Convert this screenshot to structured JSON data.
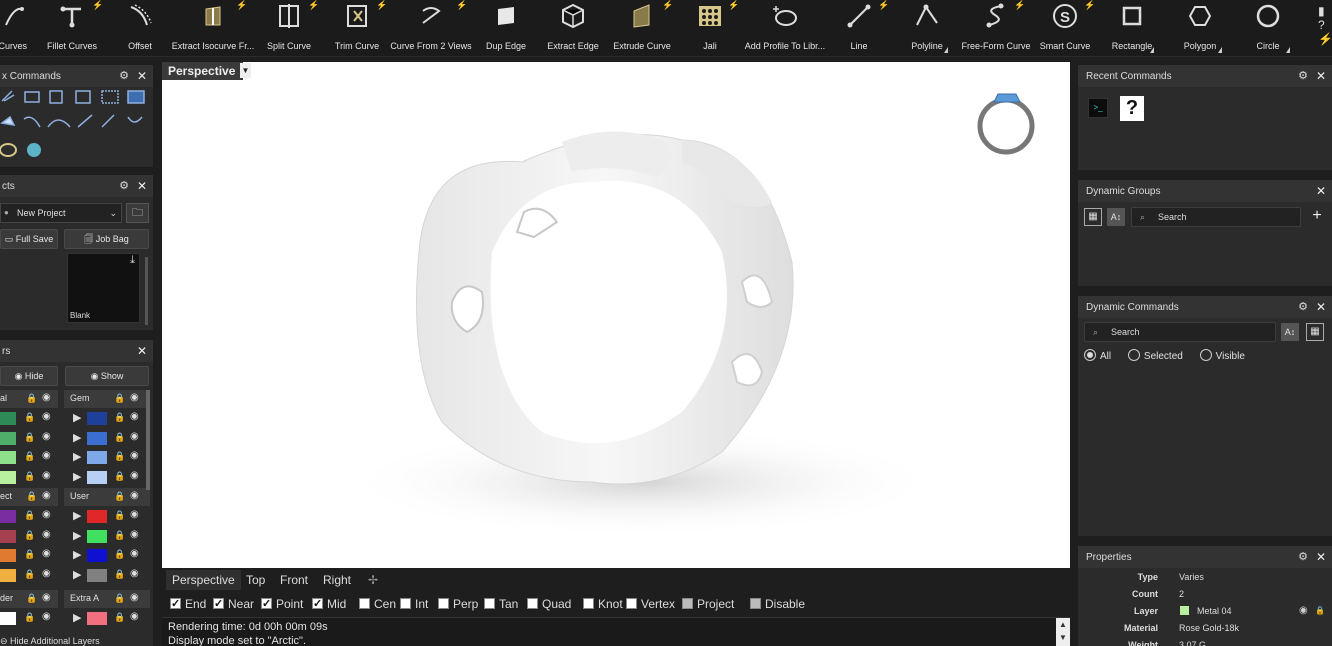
{
  "toolbar": {
    "tools": [
      {
        "label": "l Curves",
        "icon": "curves-icon"
      },
      {
        "label": "Fillet Curves",
        "icon": "fillet-curves-icon"
      },
      {
        "label": "Offset",
        "icon": "offset-icon"
      },
      {
        "label": "Extract Isocurve Fr...",
        "icon": "extract-isocurve-icon"
      },
      {
        "label": "Split Curve",
        "icon": "split-curve-icon"
      },
      {
        "label": "Trim Curve",
        "icon": "trim-curve-icon"
      },
      {
        "label": "Curve From 2 Views",
        "icon": "curve-from-2-views-icon"
      },
      {
        "label": "Dup Edge",
        "icon": "dup-edge-icon"
      },
      {
        "label": "Extract Edge",
        "icon": "extract-edge-icon"
      },
      {
        "label": "Extrude Curve",
        "icon": "extrude-curve-icon"
      },
      {
        "label": "Jali",
        "icon": "jali-icon"
      },
      {
        "label": "Add Profile To Libr...",
        "icon": "add-profile-icon"
      },
      {
        "label": "Line",
        "icon": "line-icon"
      },
      {
        "label": "Polyline",
        "icon": "polyline-icon"
      },
      {
        "label": "Free-Form Curve",
        "icon": "free-form-curve-icon"
      },
      {
        "label": "Smart Curve",
        "icon": "smart-curve-icon"
      },
      {
        "label": "Rectangle",
        "icon": "rectangle-icon"
      },
      {
        "label": "Polygon",
        "icon": "polygon-icon"
      },
      {
        "label": "Circle",
        "icon": "circle-icon"
      }
    ]
  },
  "left": {
    "commands_title": "x Commands",
    "projects_title": "cts",
    "project_select": "New Project",
    "full_save": "Full Save",
    "job_bag": "Job Bag",
    "thumb_label": "Blank",
    "layers_title": "rs",
    "hide": "Hide",
    "show": "Show",
    "group_left": [
      "al",
      "ect",
      "der"
    ],
    "group_right": [
      "Gem",
      "User",
      "Extra A"
    ],
    "hide_additional": "Hide Additional Layers"
  },
  "viewport": {
    "title": "Perspective",
    "tabs": [
      "Perspective",
      "Top",
      "Front",
      "Right"
    ]
  },
  "snaps": [
    {
      "label": "End",
      "on": true
    },
    {
      "label": "Near",
      "on": true
    },
    {
      "label": "Point",
      "on": true
    },
    {
      "label": "Mid",
      "on": true
    },
    {
      "label": "Cen",
      "on": false
    },
    {
      "label": "Int",
      "on": false
    },
    {
      "label": "Perp",
      "on": false
    },
    {
      "label": "Tan",
      "on": false
    },
    {
      "label": "Quad",
      "on": false
    },
    {
      "label": "Knot",
      "on": false
    },
    {
      "label": "Vertex",
      "on": false
    },
    {
      "label": "Project",
      "on": false
    },
    {
      "label": "Disable",
      "on": false
    }
  ],
  "cmdline": {
    "line1": "Rendering time: 0d 00h 00m 09s",
    "line2": "Display mode set to \"Arctic\"."
  },
  "right": {
    "recent_title": "Recent Commands",
    "groups_title": "Dynamic Groups",
    "groups_search": "Search",
    "commands_title": "Dynamic Commands",
    "commands_search": "Search",
    "radio_all": "All",
    "radio_selected": "Selected",
    "radio_visible": "Visible",
    "props_title": "Properties",
    "props": [
      {
        "k": "Type",
        "v": "Varies"
      },
      {
        "k": "Count",
        "v": "2"
      },
      {
        "k": "Layer",
        "v": "Metal 04"
      },
      {
        "k": "Material",
        "v": "Rose Gold-18k"
      },
      {
        "k": "Weight",
        "v": "3.07 G"
      }
    ]
  },
  "colors": {
    "accent_cyan": "#2fd0e0",
    "layer_green": "#4caf50",
    "layer_blue": "#1e4fb0"
  }
}
